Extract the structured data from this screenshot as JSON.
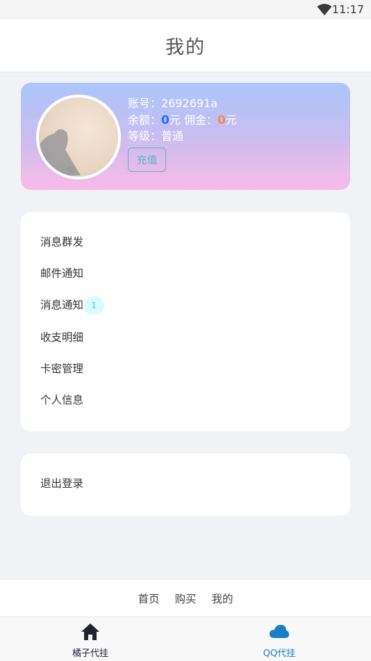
{
  "status_bar": {
    "time": "11:17"
  },
  "header": {
    "title": "我的"
  },
  "profile": {
    "account_label": "账号：",
    "account_value": "2692691a",
    "balance_label": "余额：",
    "balance_value": "0",
    "balance_unit": "元",
    "commission_label": " 佣金：",
    "commission_value": "0",
    "commission_unit": "元",
    "level_label": "等级：",
    "level_value": "普通",
    "recharge_button": "充值"
  },
  "menu": {
    "items": [
      {
        "label": "消息群发"
      },
      {
        "label": "邮件通知"
      },
      {
        "label": "消息通知",
        "badge": "1"
      },
      {
        "label": "收支明细"
      },
      {
        "label": "卡密管理"
      },
      {
        "label": "个人信息"
      }
    ]
  },
  "logout": {
    "label": "退出登录"
  },
  "footer_links": [
    "首页",
    "购买",
    "我的"
  ],
  "tabbar": {
    "tabs": [
      {
        "label": "橘子代挂",
        "icon": "home-icon",
        "color": "#1f2430"
      },
      {
        "label": "QQ代挂",
        "icon": "cloud-icon",
        "color": "#1a7fc6"
      }
    ]
  },
  "colors": {
    "balance": "#1677ff",
    "commission": "#f28a4b",
    "recharge": "#5ab2c9",
    "badge_bg": "#d9fbfb",
    "active_tab": "#1a7fc6"
  }
}
